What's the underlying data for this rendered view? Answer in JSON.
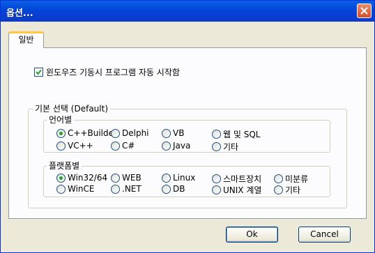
{
  "window": {
    "title": "옵션..."
  },
  "tabs": [
    {
      "label": "일반"
    }
  ],
  "general": {
    "autostart": {
      "label": "윈도우즈 기동시 프로그램 자동 시작함",
      "checked": true
    }
  },
  "default_group": {
    "label": "기본 선택 (Default)",
    "by_language": {
      "label": "언어별",
      "selected": "C++Builder",
      "options": [
        "C++Builder",
        "Delphi",
        "VB",
        "웹 및 SQL",
        "VC++",
        "C#",
        "Java",
        "기타"
      ]
    },
    "by_platform": {
      "label": "플랫폼별",
      "selected": "Win32/64",
      "options": [
        "Win32/64",
        "WEB",
        "Linux",
        "스마트장치",
        "미분류",
        "WinCE",
        ".NET",
        "DB",
        "UNIX 계열",
        "기타"
      ]
    }
  },
  "buttons": {
    "ok": "Ok",
    "cancel": "Cancel"
  },
  "colors": {
    "titlebar": "#0a5fe6",
    "face": "#ece9d8",
    "tab_accent": "#ffc83c",
    "radio_dot": "#21a121"
  }
}
